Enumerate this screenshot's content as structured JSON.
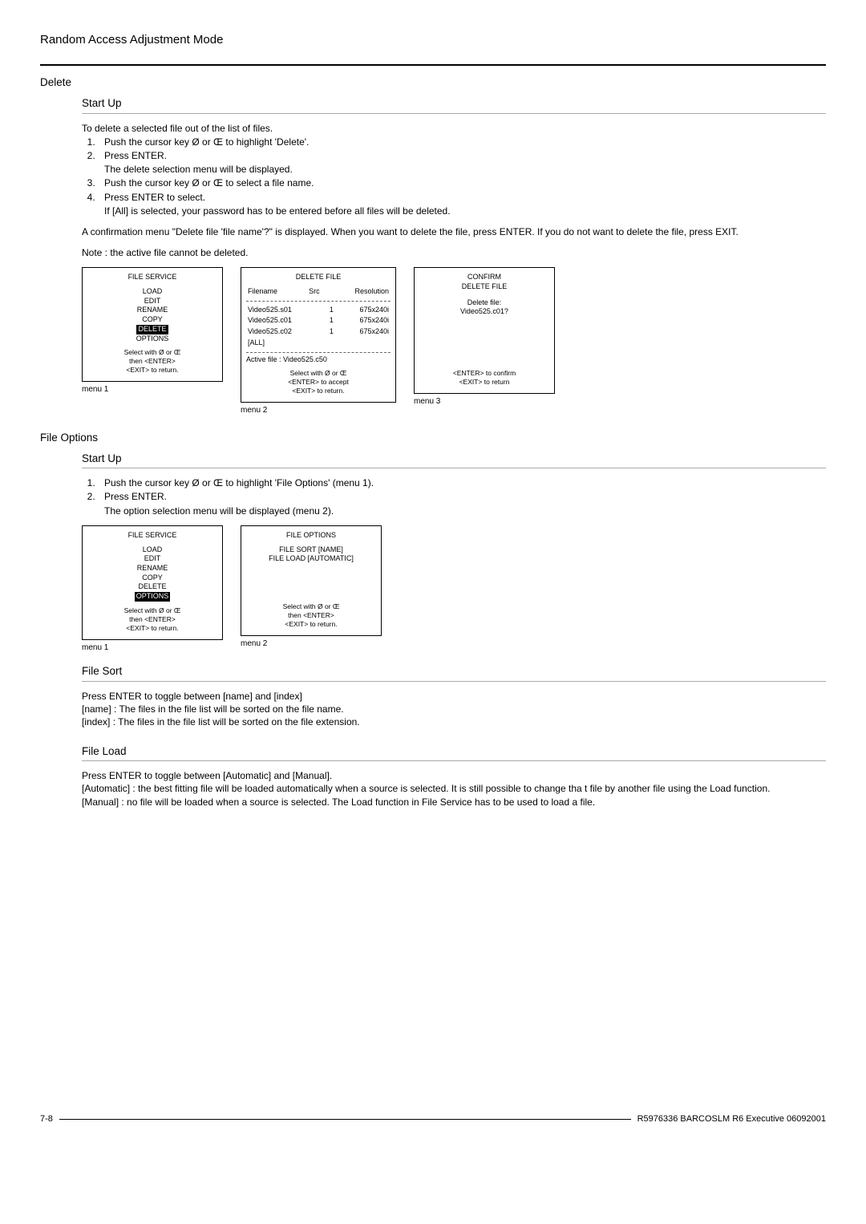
{
  "header": "Random Access Adjustment Mode",
  "delete": {
    "title": "Delete",
    "startup": {
      "title": "Start Up",
      "intro": "To delete a selected file out of the list of files.",
      "steps": [
        "Push the cursor key Ø or Œ to highlight 'Delete'.",
        "Press ENTER.",
        "Push the cursor key Ø or Œ to select a file name.",
        "Press ENTER to select."
      ],
      "sub_after_2": "The delete selection menu will be displayed.",
      "sub_after_4": "If [All] is selected, your password has to be entered before all files will be deleted.",
      "confirm_para": "A confirmation menu \"Delete file 'file name'?\" is displayed.  When you want to delete the file, press  ENTER.  If you do not want to delete the file, press  EXIT.",
      "note": "Note : the active file cannot be deleted."
    }
  },
  "file_options": {
    "title": "File Options",
    "startup": {
      "title": "Start Up",
      "steps": [
        "Push the cursor key Ø or Œ to highlight 'File Options' (menu 1).",
        "Press ENTER."
      ],
      "sub_after_2": "The option selection menu will be displayed (menu 2)."
    }
  },
  "file_sort": {
    "title": "File Sort",
    "p1": "Press ENTER to toggle between [name] and [index]",
    "p2": "[name] : The files in the file list will be sorted on the file name.",
    "p3": "[index] : The files in the file list will be sorted on the file extension."
  },
  "file_load": {
    "title": "File Load",
    "p1": "Press ENTER to toggle between [Automatic] and [Manual].",
    "p2": "[Automatic] : the best fitting file will be loaded automatically when a source is selected.  It is still possible to change tha t file by another file using the Load function.",
    "p3": "[Manual] : no file will be loaded when a source is selected. The Load function in File Service has to be used to load a file."
  },
  "menus": {
    "file_service_1": {
      "title": "FILE SERVICE",
      "items": [
        "LOAD",
        "EDIT",
        "RENAME",
        "COPY",
        "DELETE",
        "OPTIONS"
      ],
      "highlight_index": 4,
      "foot1": "Select with Ø or Œ",
      "foot2": "then <ENTER>",
      "foot3": "<EXIT> to return.",
      "label": "menu 1"
    },
    "delete_file": {
      "title": "DELETE FILE",
      "head": {
        "c1": "Filename",
        "c2": "Src",
        "c3": "Resolution"
      },
      "rows": [
        {
          "c1": "Video525.s01",
          "c2": "1",
          "c3": "675x240i"
        },
        {
          "c1": "Video525.c01",
          "c2": "1",
          "c3": "675x240i"
        },
        {
          "c1": "Video525.c02",
          "c2": "1",
          "c3": "675x240i"
        },
        {
          "c1": "[ALL]",
          "c2": "",
          "c3": ""
        }
      ],
      "active": "Active file : Video525.c50",
      "foot1": "Select with Ø or Œ",
      "foot2": "<ENTER> to accept",
      "foot3": "<EXIT> to return.",
      "label": "menu 2"
    },
    "confirm": {
      "title1": "CONFIRM",
      "title2": "DELETE FILE",
      "q1": "Delete file:",
      "q2": "Video525.c01?",
      "foot1": "<ENTER> to confirm",
      "foot2": "<EXIT> to return",
      "label": "menu 3"
    },
    "file_service_2": {
      "title": "FILE SERVICE",
      "items": [
        "LOAD",
        "EDIT",
        "RENAME",
        "COPY",
        "DELETE",
        "OPTIONS"
      ],
      "highlight_index": 5,
      "foot1": "Select with Ø or Œ",
      "foot2": "then <ENTER>",
      "foot3": "<EXIT> to return.",
      "label": "menu 1"
    },
    "file_options_menu": {
      "title": "FILE OPTIONS",
      "l1": "FILE SORT [NAME]",
      "l2": "FILE LOAD [AUTOMATIC]",
      "foot1": "Select with Ø or Œ",
      "foot2": "then <ENTER>",
      "foot3": "<EXIT> to return.",
      "label": "menu 2"
    }
  },
  "footer": {
    "left": "7-8",
    "right": "R5976336 BARCOSLM R6 Executive 06092001"
  }
}
